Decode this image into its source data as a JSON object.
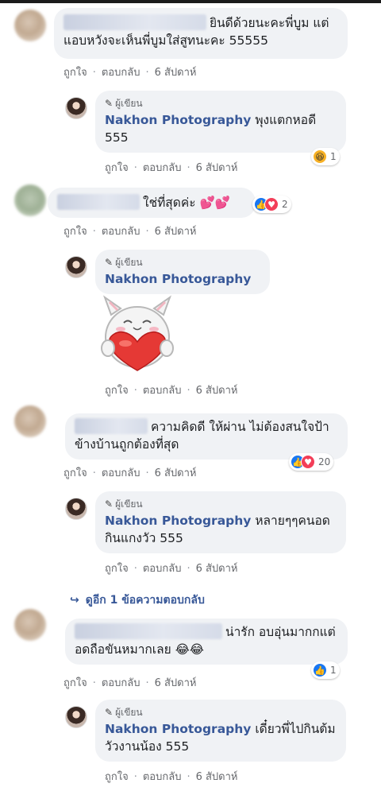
{
  "comment1": {
    "text": "ยินดีด้วยนะคะพี่บูม แต่แอบหวังจะเห็นพี่บูมใส่สูทนะคะ 55555",
    "like": "ถูกใจ",
    "reply": "ตอบกลับ",
    "time": "6 สัปดาห์"
  },
  "reply1": {
    "author_badge": "ผู้เขียน",
    "name": "Nakhon Photography",
    "text": "พุงแตกหอดี 555",
    "like": "ถูกใจ",
    "reply": "ตอบกลับ",
    "time": "6 สัปดาห์",
    "reaction_count": "1"
  },
  "comment2": {
    "text": "ใช่ที่สุดค่ะ 💕💕",
    "like": "ถูกใจ",
    "reply": "ตอบกลับ",
    "time": "6 สัปดาห์",
    "reaction_count": "2"
  },
  "reply2": {
    "author_badge": "ผู้เขียน",
    "name": "Nakhon Photography",
    "like": "ถูกใจ",
    "reply": "ตอบกลับ",
    "time": "6 สัปดาห์"
  },
  "comment3": {
    "text": "ความคิดดี ให้ผ่าน ไม่ต้องสนใจป้าข้างบ้านถูกต้องที่สุด",
    "like": "ถูกใจ",
    "reply": "ตอบกลับ",
    "time": "6 สัปดาห์",
    "reaction_count": "20"
  },
  "reply3": {
    "author_badge": "ผู้เขียน",
    "name": "Nakhon Photography",
    "text": "หลายๆๆคนอดกินแกงวัว 555",
    "like": "ถูกใจ",
    "reply": "ตอบกลับ",
    "time": "6 สัปดาห์"
  },
  "more_replies": "ดูอีก 1 ข้อความตอบกลับ",
  "comment4": {
    "text": "น่ารัก อบอุ่นมากกแต่อดถือขันหมากเลย 😂😂",
    "like": "ถูกใจ",
    "reply": "ตอบกลับ",
    "time": "6 สัปดาห์",
    "reaction_count": "1"
  },
  "reply4": {
    "author_badge": "ผู้เขียน",
    "name": "Nakhon Photography",
    "text": "เดี๋ยวพี่ไปกินต้มวัวงานน้อง 555",
    "like": "ถูกใจ",
    "reply": "ตอบกลับ",
    "time": "6 สัปดาห์"
  },
  "colors": {
    "link": "#385898",
    "bubble": "#f0f2f5",
    "like": "#1877f2",
    "love": "#f33e58",
    "haha": "#f7b125"
  }
}
